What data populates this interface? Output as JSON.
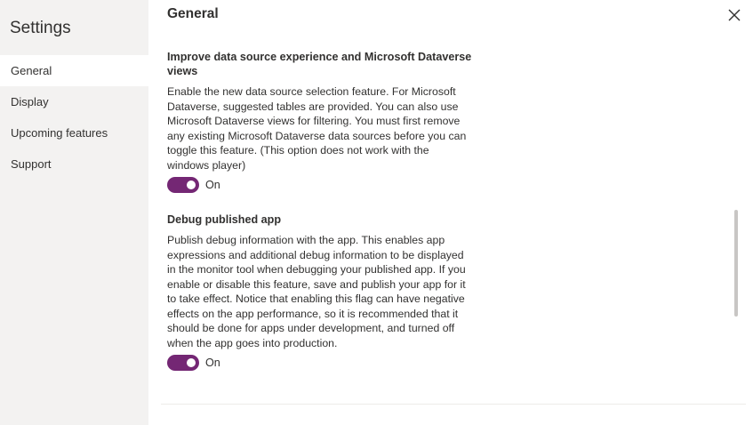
{
  "sidebar": {
    "title": "Settings",
    "items": [
      {
        "label": "General",
        "active": true
      },
      {
        "label": "Display",
        "active": false
      },
      {
        "label": "Upcoming features",
        "active": false
      },
      {
        "label": "Support",
        "active": false
      }
    ]
  },
  "main": {
    "title": "General",
    "close_icon": "close-icon",
    "sections": [
      {
        "title": "Improve data source experience and Microsoft Dataverse views",
        "description": "Enable the new data source selection feature. For Microsoft Dataverse, suggested tables are provided. You can also use Microsoft Dataverse views for filtering. You must first remove any existing Microsoft Dataverse data sources before you can toggle this feature. (This option does not work with the windows player)",
        "toggle_state": true,
        "toggle_label": "On"
      },
      {
        "title": "Debug published app",
        "description": "Publish debug information with the app. This enables app expressions and additional debug information to be displayed in the monitor tool when debugging your published app. If you enable or disable this feature, save and publish your app for it to take effect. Notice that enabling this flag can have negative effects on the app performance, so it is recommended that it should be done for apps under development, and turned off when the app goes into production.",
        "toggle_state": true,
        "toggle_label": "On"
      }
    ]
  },
  "colors": {
    "accent": "#742774",
    "sidebar_bg": "#f3f2f1",
    "text": "#323130"
  }
}
